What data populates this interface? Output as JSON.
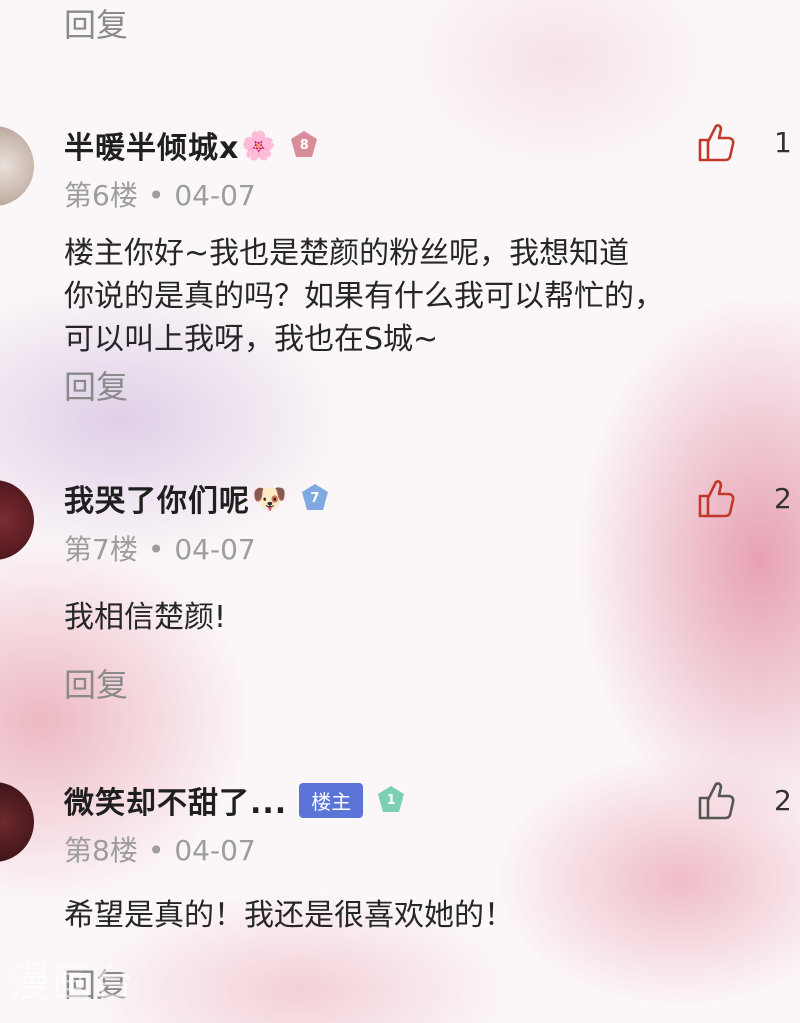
{
  "top_reply_label": "回复",
  "comments": [
    {
      "username": "半暖半倾城x",
      "emoji": "🌸",
      "level": "8",
      "level_color": "#d98c9a",
      "floor": "第6楼",
      "date": "04-07",
      "content_lines": [
        "楼主你好~我也是楚颜的粉丝呢，我想知道",
        "你说的是真的吗？如果有什么我可以帮忙的，",
        "可以叫上我呀，我也在S城~"
      ],
      "reply_label": "回复",
      "like_count": "1",
      "like_color": "#c0392b"
    },
    {
      "username": "我哭了你们呢",
      "emoji": "🐶",
      "level": "7",
      "level_color": "#7fa9e0",
      "floor": "第7楼",
      "date": "04-07",
      "content_lines": [
        "我相信楚颜!"
      ],
      "reply_label": "回复",
      "like_count": "2",
      "like_color": "#c0392b"
    },
    {
      "username": "微笑却不甜了...",
      "owner_tag": "楼主",
      "level": "1",
      "level_color": "#7ccfb3",
      "floor": "第8楼",
      "date": "04-07",
      "content_lines": [
        "希望是真的！我还是很喜欢她的！"
      ],
      "reply_label": "回复",
      "like_count": "2",
      "like_color": "#555555"
    }
  ],
  "watermark": "漫画台"
}
